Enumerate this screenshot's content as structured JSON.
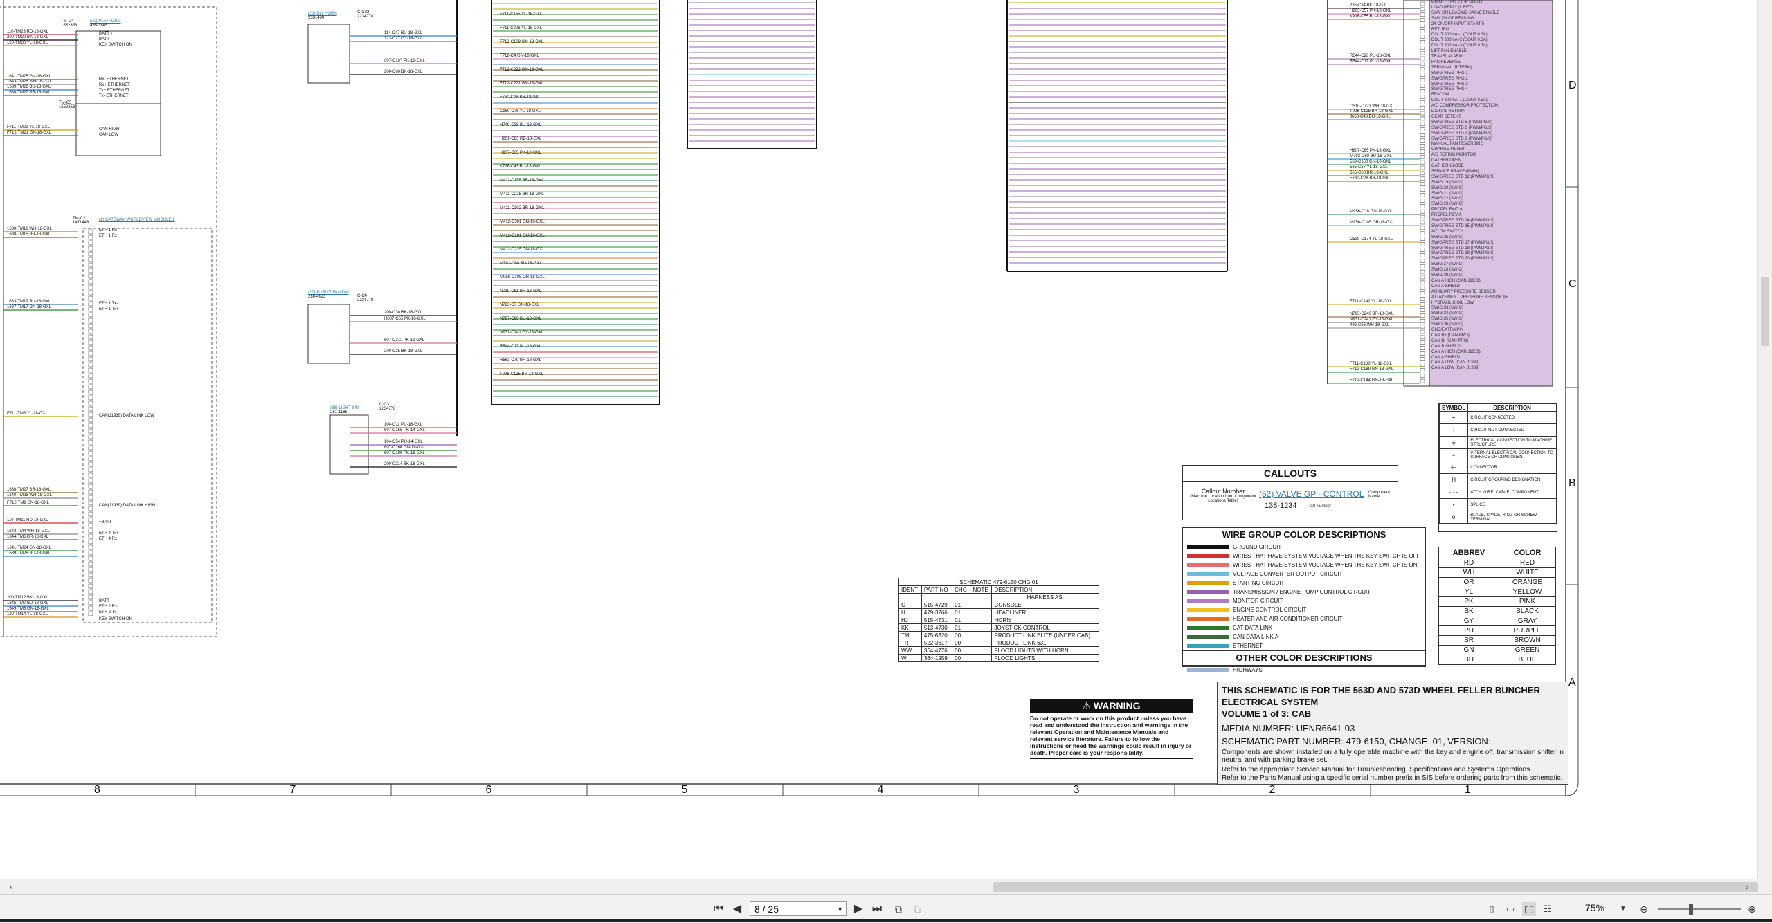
{
  "schematic": {
    "grid_numbers": [
      "8",
      "7",
      "6",
      "5",
      "4",
      "3",
      "2",
      "1"
    ],
    "grid_letters": [
      "D",
      "C",
      "B",
      "A"
    ],
    "labels_left": [
      {
        "text": "TM-C4",
        "sub": "1552353"
      },
      {
        "text": "(20) PLATFORM",
        "sub": "455-3845"
      },
      {
        "text": "TM-C5",
        "sub": "1552353"
      },
      {
        "text": "TM-C2",
        "sub": "1471448"
      },
      {
        "text": "(1) GATEWAY WORLDVIEW MODULE 1",
        "sub": ""
      },
      {
        "text": "(31) DW HORN",
        "sub": "2631490"
      },
      {
        "text": "C-C32",
        "sub": "2234778"
      },
      {
        "text": "(37) PURGE FAN DW",
        "sub": "236-4623"
      },
      {
        "text": "C-C4",
        "sub": "2234778"
      },
      {
        "text": "(38) LIGHT SW",
        "sub": "281-1185"
      },
      {
        "text": "C-C31",
        "sub": "2234778"
      }
    ],
    "left_signals": [
      "110-TM23 RD-18-GXL",
      "200-TM20 BK-18-GXL",
      "120-TM30 YL-18-GXL",
      "1641-TM25 GN-18-GXL",
      "1643-TM26 WH-18-GXL",
      "1639-TM28 BU-18-GXL",
      "1638-TM27 BR-18-GXL",
      "F711-TM22 YL-18-GXL",
      "F712-TM21 GN-18-GXL",
      "1630-TM18 WH-18-GXL",
      "1638-TM15 BR-18-GXL",
      "1633-TM19 BU-18-GXL",
      "1637-TM17 GN-18-GXL",
      "F711-TM8 YL-18-GXL",
      "1638-TM27 BR-18-GXL",
      "1640-TM25 WH-18-GXL",
      "F712-TM9 GN-18-GXL",
      "110-TM11 RD-18-GXL",
      "1643-TM4 WH-18-GXL",
      "1644-TM6 BR-18-GXL",
      "1641-TM24 GN-18-GXL",
      "1639-TM26 BU-18-GXL",
      "200-TM12 BK-18-GXL",
      "1645-TM7 BU-18-GXL",
      "1649-TM8 GN-18-GXL",
      "120-TM14 YL-18-GXL"
    ],
    "left_pin_labels": [
      "BATT +",
      "BATT -",
      "KEY SWITCH ON",
      "Rx- ETHERNET",
      "Rx+ ETHERNET",
      "Tx+ ETHERNET",
      "Tx- ETHERNET",
      "CAN HIGH",
      "CAN LOW",
      "ETH 1 Rx-",
      "ETH 1 Rx+",
      "ETH 1 Tx-",
      "ETH 1 Tx+",
      "CAN(J1939) DATA LINK LOW",
      "CAN(J1939) DATA LINK HIGH",
      "+BATT",
      "ETH 4 Tx+",
      "ETH 4 Rx+",
      "BATT -",
      "ETH 2 Rx-",
      "ETH 2 Tx-",
      "KEY SWITCH ON"
    ],
    "center_signals": [
      "114-C47 BU-18-GXL",
      "323-C27 GY-18-GXL",
      "607-C167 PK-18-GXL",
      "200-C60 BK-18-GXL",
      "200-C30 BK-18-GXL",
      "H807-C65 PK-18-GXL",
      "607-C211 PK-18-GXL",
      "200-C25 BK-18-GXL",
      "104-C11 PU-18-GXL",
      "607-C155 PK-14-GXL",
      "104-C54 PU-14-GXL",
      "607-C166 GN-18-GXL",
      "607-C180 PK-18-GXL",
      "200-C214 BK-18-GXL"
    ],
    "bus_signals": [
      "F711-C155 YL-18-GXL",
      "F711-C206 YL-18-GXL",
      "F712-C108 GN-18-GXL",
      "F712-C4 GN-18-GXL",
      "F712-C222 GN-18-GXL",
      "F712-C221 GN-18-GXL",
      "F760-C28 BR-18-GXL",
      "C969-C76 YL-18-GXL",
      "H749-C38 BU-18-GXL",
      "H801-C83 RD-18-GXL",
      "H807-C65 PK-18-GXL",
      "K726-C43 BU-18-GXL",
      "M411-C155 BR-18-GXL",
      "M411-C225 BR-18-GXL",
      "M411-C302 BR-18-GXL",
      "M412-C301 GN-18-GXL",
      "M412-C181 GN-18-GXL",
      "M412-C225 GN-18-GXL",
      "M792-C60 BU-18-GXL",
      "M956-C105 OR-18-GXL",
      "N719-C61 BR-18-GXL",
      "N723-C7 GN-18-GXL",
      "N787-C96 BU-18-GXL",
      "N931-C241 GY-18-GXL",
      "R544-C17 PU-18-GXL",
      "R563-C79 BR-18-GXL",
      "T996-C125 BR-18-GXL"
    ],
    "right_pin_labels": [
      "ON/OFF RAT 2 (HP DOUT)",
      "LOAD REPLY (L.RET)",
      "SAW ON LOADING VALVE ENABLE",
      "SAW PILOT READING",
      "24 ON/OFF INPUT START 5",
      "RETURN",
      "DOUT 300mA -1 (DOUT 0.3A)",
      "DOUT 300mA -2 (DOUT 0.3A)",
      "DOUT 300mA -3 (DOUT 0.3A)",
      "LIFT FAN ENABLE",
      "TRAVEL ALARM",
      "FAN REVERSE",
      "TERMINAL (R TERM)",
      "SW/GPREG PHG 1",
      "SW/GPREG PHG 2",
      "SW/GPREG PHG 3",
      "SW/GPREG PHG 4",
      "BEACON",
      "DOUT 300mA -1 (DOUT 0.3A)",
      "A/C COMPRESSOR PROTECTION",
      "DIGITAL RETURN",
      "GEAR DETENT",
      "SW/GPREG STD 5 (PWM/PG/S)",
      "SW/GPREG STD 6 (PWM/PG/S)",
      "SW/GPREG STD 7 (PWM/PG/S)",
      "SW/GPREG STD 8 (PWM/PG/S)",
      "MANUAL FAN REVERSING",
      "CHARGE FILTER",
      "A/C REFRIG MONITOR",
      "GATHER OPEN",
      "GATHER CLOSE",
      "SERVICE BRAKE (PWM)",
      "SW/GPREG STD 12 (PWM/PG/S)",
      "SWIG 19 (SWIG)",
      "SWIG 20 (SWIG)",
      "SWIG 21 (SWIG)",
      "SWIG 22 (SWIG)",
      "SWIG 23 (SWIG)",
      "PROPEL FWD A",
      "PROPEL REV A",
      "SW/GPREG STD 14 (PWM/PG/S)",
      "SW/GPREG STD 15 (PWM/PG/S)",
      "A/C ON SWITCH",
      "SWIG 25 (SWIG)",
      "SW/GPREG STD 17 (PWM/PG/S)",
      "SW/GPREG STD 18 (PWM/PG/S)",
      "SW/GPREG STD 19 (PWM/PG/S)",
      "SW/GPREG STD 20 (PWM/PG/S)",
      "SWIG 27 (SWIG)",
      "SWIG 28 (SWIG)",
      "SWIG 29 (SWIG)",
      "CAN A HIGH (CAN J1939)",
      "CAN A SHIELD",
      "AUXILIARY PRESSURE SENSOR",
      "ATTACHMENT PRESSURE SENSOR A+",
      "HYDRAULIC OIL LOW",
      "SWIG 33 (SWIG)",
      "SWIG 34 (SWIG)",
      "SWIG 35 (SWIG)",
      "SWIG 36 (SWIG)",
      "GND/EXTRA PIN",
      "CAN B+ (CAN PRO)",
      "CAN B- (CAN PRO)",
      "CAN B SHIELD",
      "CAN A HIGH (CAN J1939)",
      "CAN A SHIELD",
      "CAN A LOW (CAN J1939)",
      "CAN A LOW (CAN J1939)"
    ],
    "right_signals": [
      "235-C34 BK-18-GXL",
      "H803-C57 PK-18-GXL",
      "K916-C55 BU-18-GXL",
      "R544-C28 PU-18-GXL",
      "R544-C17 PU-18-GXL",
      "C510-C723 WH-18-GXL",
      "T996-C125 BR-18-GXL",
      "J663-C48 BU-18-GXL",
      "H807-C65 PK-18-GXL",
      "M792-C60 BU-18-GXL",
      "569-C160 GN-18-GXL",
      "565-C57 YL-18-GXL",
      "566-C68 BR-18-GXL",
      "F760-C28 BR-18-GXL",
      "M956-C18 GN-18-GXL",
      "M956-C105 OR-18-GXL",
      "C539-C174 YL-18-GXL",
      "F711-C142 YL-18-GXL",
      "N793-C240 BR-18-GXL",
      "N931-C241 GY-18-GXL",
      "496-C56 WH-18-GXL",
      "F711-C188 YL-18-GXL",
      "F712-C189 GN-18-GXL",
      "F712-C144 GN-18-GXL"
    ]
  },
  "schematic_table": {
    "title": "SCHEMATIC 479-6150 CHG 01",
    "headers": [
      "IDENT",
      "PART NO",
      "CHG",
      "NOTE",
      "DESCRIPTION"
    ],
    "subheader": "HARNESS AS.",
    "rows": [
      [
        "C",
        "515-4729",
        "01",
        "",
        "CONSOLE"
      ],
      [
        "H",
        "479-3266",
        "01",
        "",
        "HEADLINER"
      ],
      [
        "HJ",
        "515-4731",
        "01",
        "",
        "HORN"
      ],
      [
        "KK",
        "513-4730",
        "01",
        "",
        "JOYSTICK CONTROL"
      ],
      [
        "TM",
        "475-6320",
        "00",
        "",
        "PRODUCT LINK ELITE (UNDER CAB)"
      ],
      [
        "TR",
        "522-3617",
        "00",
        "",
        "PRODUCT LINK 631"
      ],
      [
        "WW",
        "364-4776",
        "00",
        "",
        "FLOOD LIGHTS WITH HORN"
      ],
      [
        "W",
        "364-1959",
        "00",
        "",
        "FLOOD LIGHTS"
      ]
    ]
  },
  "callouts": {
    "title": "CALLOUTS",
    "callout_number": "Callout Number",
    "callout_desc": "(Machine Location from Component Locations Table)",
    "example": "(52) VALVE GP - CONTROL",
    "part": "138-1234",
    "component_name": "Component Name",
    "part_number": "Part Number"
  },
  "wire_groups": {
    "title": "WIRE GROUP COLOR DESCRIPTIONS",
    "items": [
      {
        "color": "#111111",
        "label": "GROUND CIRCUIT"
      },
      {
        "color": "#d03030",
        "label": "WIRES THAT HAVE SYSTEM VOLTAGE WHEN THE KEY SWITCH IS OFF"
      },
      {
        "color": "#e07070",
        "label": "WIRES THAT HAVE SYSTEM VOLTAGE WHEN THE KEY SWITCH IS ON"
      },
      {
        "color": "#6bbcd8",
        "label": "VOLTAGE CONVERTER OUTPUT CIRCUIT"
      },
      {
        "color": "#e0a000",
        "label": "STARTING CIRCUIT"
      },
      {
        "color": "#9a60b0",
        "label": "TRANSMISSION / ENGINE PUMP CONTROL CIRCUIT"
      },
      {
        "color": "#b07ac8",
        "label": "MONITOR CIRCUIT"
      },
      {
        "color": "#f0c020",
        "label": "ENGINE CONTROL CIRCUIT"
      },
      {
        "color": "#e07020",
        "label": "HEATER AND AIR CONDITIONER CIRCUIT"
      },
      {
        "color": "#2a7a2a",
        "label": "CAT DATA LINK"
      },
      {
        "color": "#3a6a3a",
        "label": "CAN DATA LINK A"
      },
      {
        "color": "#3aa0c0",
        "label": "ETHERNET"
      }
    ],
    "other_title": "OTHER COLOR DESCRIPTIONS",
    "other_items": [
      {
        "color": "#9ab0d8",
        "label": "HIGHWAYS"
      }
    ]
  },
  "symbols": {
    "headers": [
      "SYMBOL",
      "DESCRIPTION"
    ],
    "rows": [
      {
        "sym": "+",
        "desc": "CIRCUIT CONNECTED"
      },
      {
        "sym": "+",
        "desc": "CIRCUIT NOT CONNECTED"
      },
      {
        "sym": "⏚",
        "desc": "ELECTRICAL CONNECTION TO MACHINE STRUCTURE"
      },
      {
        "sym": "⏚",
        "desc": "INTERNAL ELECTRICAL CONNECTION TO SURFACE OF COMPONENT"
      },
      {
        "sym": "-⊢",
        "desc": "CONNECTOR"
      },
      {
        "sym": "H",
        "desc": "CIRCUIT GROUPING DESIGNATION"
      },
      {
        "sym": "- - -",
        "desc": "ATCH WIRE, CABLE, COMPONENT"
      },
      {
        "sym": "•",
        "desc": "SPLICE"
      },
      {
        "sym": "o",
        "desc": "BLADE, SPADE, RING OR SCREW TERMINAL"
      }
    ]
  },
  "abbrev": {
    "headers": [
      "ABBREV",
      "COLOR"
    ],
    "rows": [
      [
        "RD",
        "RED"
      ],
      [
        "WH",
        "WHITE"
      ],
      [
        "OR",
        "ORANGE"
      ],
      [
        "YL",
        "YELLOW"
      ],
      [
        "PK",
        "PINK"
      ],
      [
        "BK",
        "BLACK"
      ],
      [
        "GY",
        "GRAY"
      ],
      [
        "PU",
        "PURPLE"
      ],
      [
        "BR",
        "BROWN"
      ],
      [
        "GN",
        "GREEN"
      ],
      [
        "BU",
        "BLUE"
      ]
    ]
  },
  "warning": {
    "title": "WARNING",
    "text": "Do not operate or work on this product unless you have read and understood the instruction and warnings in the relevant Operation and Maintenance Manuals and relevant service literature. Failure to follow the instructions or heed the warnings could result in injury or death. Proper care is your responsibility."
  },
  "title_block": {
    "line1": "THIS SCHEMATIC IS FOR THE 563D AND 573D WHEEL FELLER BUNCHER",
    "line2": "ELECTRICAL SYSTEM",
    "line3": "VOLUME 1 of 3: CAB",
    "media": "MEDIA NUMBER:  UENR6641-03",
    "part": "SCHEMATIC PART NUMBER: 479-6150, CHANGE: 01, VERSION: -",
    "note1": "Components are shown installed on a fully operable machine with the key and engine off, transmission shifter in neutral and with parking brake set.",
    "note2": "Refer to the appropriate Service Manual for Troubleshooting, Specifications and Systems Operations.",
    "note3": "Refer to the Parts Manual using a specific serial number prefix in SIS before ordering parts from this schematic."
  },
  "viewer": {
    "page_value": "8 / 25",
    "zoom": "75%",
    "first_icon": "first-page-icon",
    "prev_icon": "prev-page-icon",
    "next_icon": "next-page-icon",
    "last_icon": "last-page-icon"
  }
}
